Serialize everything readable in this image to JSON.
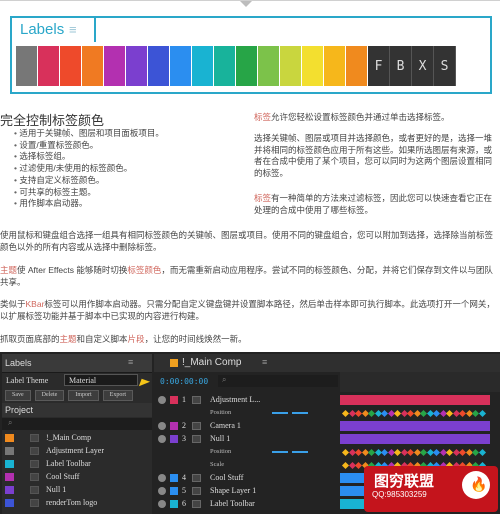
{
  "toolbar": {
    "title": "Labels",
    "swatch_colors": [
      "#777777",
      "#d8315b",
      "#ee4a2b",
      "#f07a22",
      "#b330b0",
      "#7b3fcf",
      "#3c54d6",
      "#2b8ef0",
      "#19b3d2",
      "#18b39b",
      "#27a547",
      "#7cc24a",
      "#c9d63e",
      "#f3df2f",
      "#f6b71b",
      "#f08a1e"
    ],
    "buttons": [
      "F",
      "B",
      "X",
      "S"
    ]
  },
  "section_title": "完全控制标签颜色",
  "features": [
    "适用于关键帧、图层和项目面板项目。",
    "设置/重置标签颜色。",
    "选择标签组。",
    "过滤使用/未使用的标签颜色。",
    "支持自定义标签颜色。",
    "可共享的标签主题。",
    "用作脚本启动器。"
  ],
  "right_col": {
    "p1_kw": "标签",
    "p1_rest": "允许您轻松设置标签颜色并通过单击选择标签。",
    "p2": "选择关键帧、图层或项目并选择颜色，或者更好的是，选择一堆并将相同的标签颜色应用于所有这些。如果所选图层有来源，或者在合成中使用了某个项目，您可以同时为这两个图层设置相同的标签。",
    "p3_kw": "标签",
    "p3_rest": "有一种简单的方法来过滤标签，因此您可以快速查看它正在处理的合成中使用了哪些标签。"
  },
  "paragraphs": {
    "p4": "使用鼠标和键盘组合选择一组具有相同标签颜色的关键帧、图层或项目。使用不同的键盘组合，您可以附加到选择，选择除当前标签颜色以外的所有内容或从选择中删除标签。",
    "p5_kw": "主题",
    "p5_a": "使 After Effects 能够随时切换",
    "p5_kw2": "标签颜色",
    "p5_b": "，而无需重新启动应用程序。尝试不同的标签颜色、分配，并将它们保存到文件以与团队共享。",
    "p6_a": "类似于",
    "p6_kw": "KBar",
    "p6_b": "标签可以用作脚本启动器。只需分配自定义键盘键并设置脚本路径，然后单击样本即可执行脚本。此选项打开一个网关，以扩展标签功能并基于脚本中已实现的内容进行构建。",
    "p7_a": "抓取页面底部的",
    "p7_kw1": "主题",
    "p7_b": "和自定义脚本",
    "p7_kw2": "片段",
    "p7_c": "，让您的时间线焕然一新。"
  },
  "labels_panel": {
    "title": "Labels",
    "theme_label": "Label Theme",
    "theme_value": "Material",
    "buttons": [
      "Save",
      "Delete",
      "Import",
      "Export"
    ]
  },
  "project_panel": {
    "title": "Project",
    "items": [
      {
        "name": "!_Main Comp",
        "color": "#f08a1e"
      },
      {
        "name": "Adjustment Layer",
        "color": "#777777"
      },
      {
        "name": "Label Toolbar",
        "color": "#19b3d2"
      },
      {
        "name": "Cool Stuff",
        "color": "#b330b0"
      },
      {
        "name": "Null 1",
        "color": "#7b3fcf"
      },
      {
        "name": "renderTom logo",
        "color": "#3c54d6"
      }
    ]
  },
  "timeline": {
    "comp_title": "!_Main Comp",
    "timecode": "0:00:00:00",
    "layers": [
      {
        "num": "1",
        "name": "Adjustment L...",
        "color": "#d8315b",
        "bar": "#d8315b"
      },
      {
        "num": "2",
        "name": "Camera 1",
        "color": "#b330b0",
        "bar": "#7b3fcf"
      },
      {
        "num": "3",
        "name": "Null 1",
        "color": "#7b3fcf",
        "bar": "#7b3fcf"
      },
      {
        "num": "4",
        "name": "Cool Stuff",
        "color": "#2b8ef0",
        "bar": "#2b8ef0"
      },
      {
        "num": "5",
        "name": "Shape Layer 1",
        "color": "#2b8ef0",
        "bar": "#2b8ef0"
      },
      {
        "num": "6",
        "name": "Label Toolbar",
        "color": "#19b3d2",
        "bar": "#19b3d2"
      }
    ],
    "props": [
      "Position",
      "Position",
      "Scale"
    ],
    "keyframe_colors": [
      "#f6b71b",
      "#d8315b",
      "#ee4a2b",
      "#f08a1e",
      "#27a547",
      "#19b3d2",
      "#2b8ef0",
      "#b330b0"
    ]
  },
  "watermark": {
    "title": "图穷联盟",
    "qq": "QQ:985303259"
  }
}
